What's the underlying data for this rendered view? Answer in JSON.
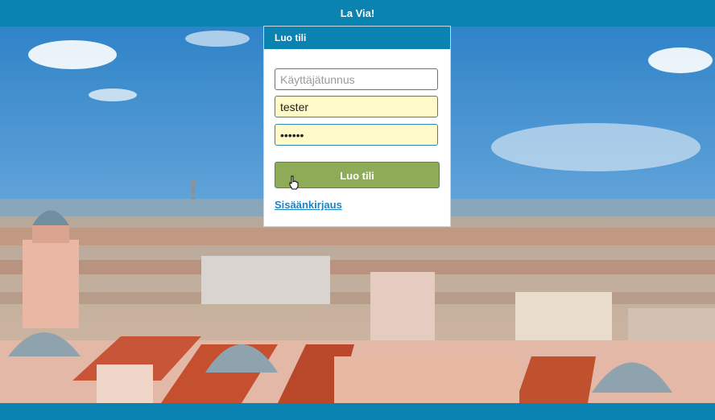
{
  "app": {
    "title": "La Via!"
  },
  "signup": {
    "header": "Luo tili",
    "username_placeholder": "Käyttäjätunnus",
    "email_value": "tester",
    "password_value": "******",
    "submit_label": "Luo tili",
    "login_link": "Sisäänkirjaus"
  },
  "colors": {
    "brand": "#0a83b1",
    "submit": "#8eab57",
    "field_fill": "#fffac8",
    "link": "#1b84c2"
  },
  "icons": {
    "cursor": "hand-pointer-icon"
  }
}
